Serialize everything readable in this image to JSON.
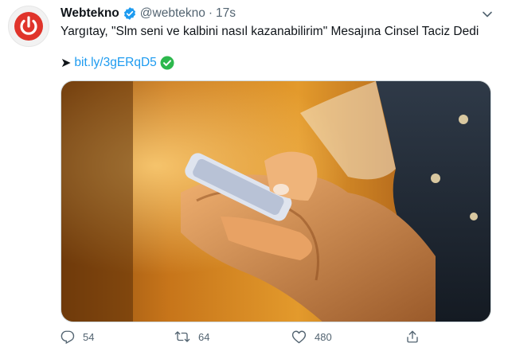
{
  "account": {
    "name": "Webtekno",
    "handle": "@webtekno",
    "separator": "·",
    "time": "17s",
    "verified": true,
    "avatar_icon": "power-icon"
  },
  "tweet": {
    "text": "Yargıtay, \"Slm seni ve kalbini nasıl kazanabilirim\" Mesajına Cinsel Taciz Dedi",
    "link_prefix": "➤",
    "link_text": "bit.ly/3gERqD5",
    "link_suffix_icon": "green-check-icon"
  },
  "media": {
    "image_icon": "photo-hands-holding-phone",
    "alt": ""
  },
  "actions": {
    "reply_count": "54",
    "retweet_count": "64",
    "like_count": "480"
  },
  "colors": {
    "brand_red": "#e0342b",
    "link_blue": "#1d9bf0",
    "verified_blue": "#1d9bf0",
    "muted": "#536471",
    "check_green": "#2db84d"
  }
}
